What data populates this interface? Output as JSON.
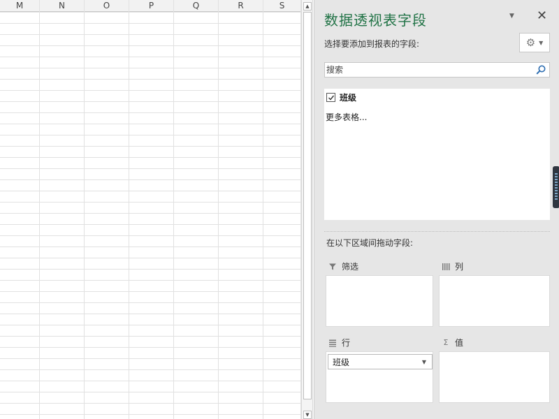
{
  "sheet": {
    "columns": [
      "M",
      "N",
      "O",
      "P",
      "Q",
      "R",
      "S"
    ]
  },
  "scrollbar": {
    "up_glyph": "▲",
    "down_glyph": "▼"
  },
  "pane": {
    "title": "数据透视表字段",
    "dropdown_glyph": "▼",
    "close_glyph": "✕",
    "choose_fields_label": "选择要添加到报表的字段:",
    "tools_icon": "gear-icon",
    "search": {
      "placeholder": "搜索",
      "value": ""
    },
    "fields": [
      {
        "label": "班级",
        "checked": true
      }
    ],
    "more_tables": "更多表格...",
    "drag_label": "在以下区域间拖动字段:",
    "areas": {
      "filter": {
        "label": "筛选",
        "icon": "filter-icon"
      },
      "columns": {
        "label": "列",
        "icon": "columns-icon"
      },
      "rows": {
        "label": "行",
        "icon": "rows-icon",
        "items": [
          "班级"
        ]
      },
      "values": {
        "label": "值",
        "icon": "sigma-icon"
      }
    }
  },
  "colors": {
    "title_green": "#217346",
    "pane_bg": "#e6e6e6"
  }
}
